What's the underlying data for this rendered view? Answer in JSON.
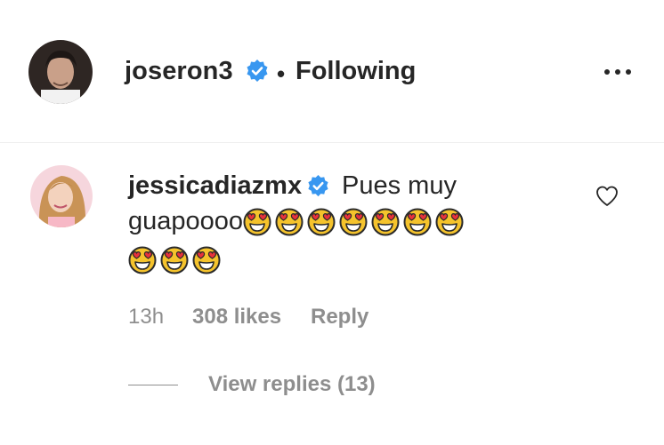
{
  "post_header": {
    "username": "joseron3",
    "separator": "•",
    "follow_status": "Following",
    "verified_icon": "verified-badge-icon",
    "more_icon": "more-options-icon"
  },
  "comment": {
    "username": "jessicadiazmx",
    "text_line1": "Pues muy",
    "text_line2": "guapoooo",
    "emoji_name": "smiling-face-with-heart-eyes",
    "emoji_count_line2": 7,
    "emoji_count_line3": 3,
    "timestamp": "13h",
    "likes": "308 likes",
    "reply_label": "Reply",
    "like_icon": "heart-outline-icon"
  },
  "replies": {
    "label": "View replies (13)"
  },
  "colors": {
    "text": "#262626",
    "muted": "#8e8e8e",
    "verified": "#3897f0",
    "divider": "#efefef"
  }
}
